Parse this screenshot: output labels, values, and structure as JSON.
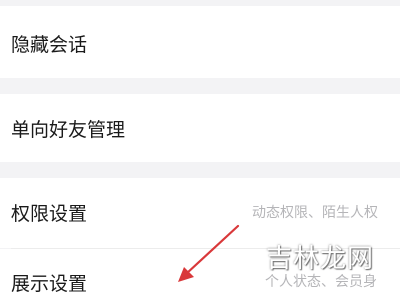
{
  "settings": {
    "items": [
      {
        "label": "隐藏会话",
        "subtitle": ""
      },
      {
        "label": "单向好友管理",
        "subtitle": ""
      },
      {
        "label": "权限设置",
        "subtitle": "动态权限、陌生人权"
      },
      {
        "label": "展示设置",
        "subtitle": "个人状态、会员身"
      }
    ]
  },
  "watermark": {
    "text": "吉林龙网"
  },
  "arrow": {
    "color": "#d9383a"
  }
}
